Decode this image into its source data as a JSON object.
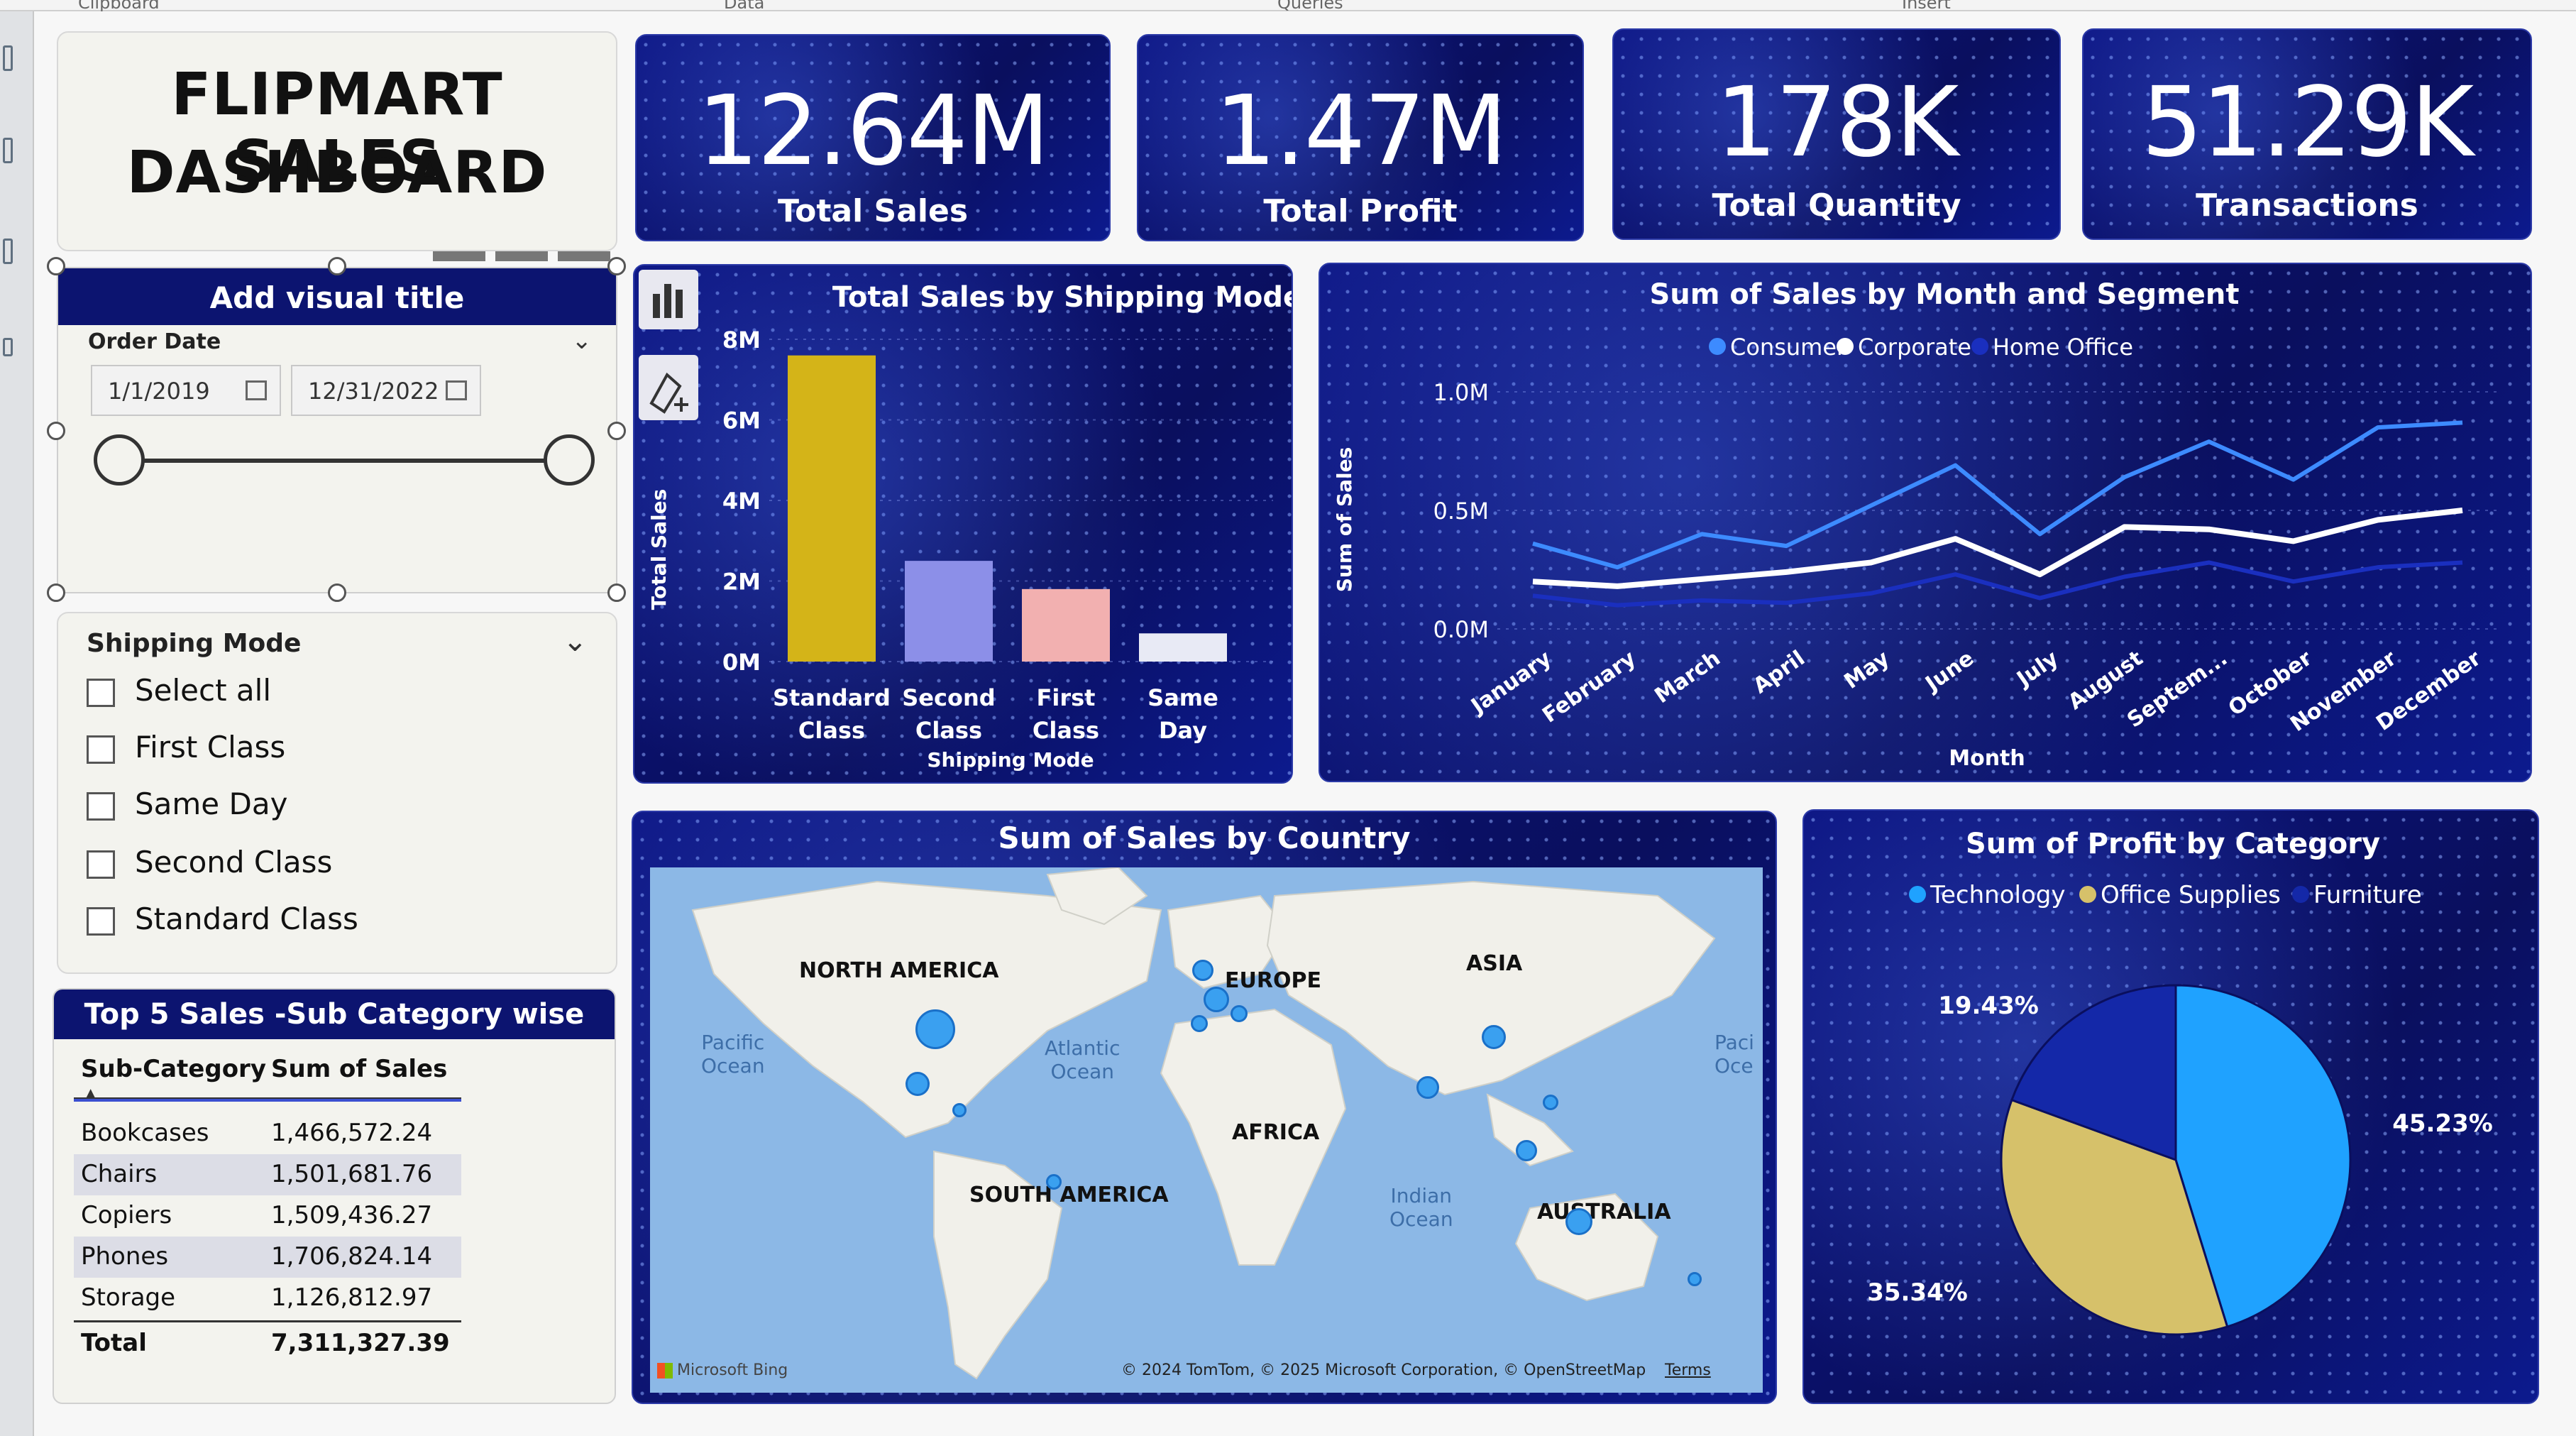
{
  "ribbon": {
    "labels": [
      "Clipboard",
      "Data",
      "Queries",
      "Insert"
    ]
  },
  "title": {
    "line1": "FLIPMART SALES",
    "line2": "DASHBOARD"
  },
  "kpis": [
    {
      "value": "12.64M",
      "label": "Total Sales"
    },
    {
      "value": "1.47M",
      "label": "Total Profit"
    },
    {
      "value": "178K",
      "label": "Total Quantity"
    },
    {
      "value": "51.29K",
      "label": "Transactions"
    }
  ],
  "date_slicer": {
    "visual_title": "Add visual title",
    "header": "Order Date",
    "start": "1/1/2019",
    "end": "12/31/2022",
    "range": [
      0,
      1
    ]
  },
  "shipping_slicer": {
    "header": "Shipping Mode",
    "options": [
      "Select all",
      "First Class",
      "Same Day",
      "Second Class",
      "Standard Class"
    ]
  },
  "top5": {
    "title": "Top 5 Sales -Sub Category wise",
    "columns": [
      "Sub-Category",
      "Sum of Sales"
    ],
    "rows": [
      [
        "Bookcases",
        "1,466,572.24"
      ],
      [
        "Chairs",
        "1,501,681.76"
      ],
      [
        "Copiers",
        "1,509,436.27"
      ],
      [
        "Phones",
        "1,706,824.14"
      ],
      [
        "Storage",
        "1,126,812.97"
      ]
    ],
    "total": [
      "Total",
      "7,311,327.39"
    ]
  },
  "map": {
    "title": "Sum of Sales by Country",
    "labels": [
      "NORTH AMERICA",
      "EUROPE",
      "ASIA",
      "AFRICA",
      "SOUTH AMERICA",
      "AUSTRALIA"
    ],
    "oceans": [
      "Pacific",
      "Ocean",
      "Atlantic",
      "Ocean",
      "Indian",
      "Ocean",
      "Paci",
      "Oce"
    ],
    "bing": "Microsoft Bing",
    "credits": "© 2024 TomTom, © 2025 Microsoft Corporation, © OpenStreetMap",
    "terms": "Terms"
  },
  "colors": {
    "navy": "#0a0f5e",
    "consumer": "#3d8bff",
    "corporate": "#ffffff",
    "home_office": "#1a2fbf",
    "standard": "#d4b418",
    "second": "#8c8fe8",
    "first": "#f2b0b0",
    "same": "#e8eaf5",
    "technology": "#1fa2ff",
    "office_supplies": "#d6c16a",
    "furniture": "#1428a8"
  },
  "chart_data": [
    {
      "type": "bar",
      "title": "Total Sales by Shipping Mode",
      "xlabel": "Shipping Mode",
      "ylabel": "Total Sales",
      "categories": [
        "Standard Class",
        "Second Class",
        "First Class",
        "Same Day"
      ],
      "values": [
        7.6,
        2.5,
        1.8,
        0.7
      ],
      "unit": "M",
      "yticks": [
        "0M",
        "2M",
        "4M",
        "6M",
        "8M"
      ],
      "ylim": [
        0,
        8
      ],
      "grid": true
    },
    {
      "type": "line",
      "title": "Sum of Sales by Month and Segment",
      "xlabel": "Month",
      "ylabel": "Sum of Sales",
      "categories": [
        "January",
        "February",
        "March",
        "April",
        "May",
        "June",
        "July",
        "August",
        "Septem...",
        "October",
        "November",
        "December"
      ],
      "yticks": [
        "0.0M",
        "0.5M",
        "1.0M"
      ],
      "ylim": [
        0,
        1.0
      ],
      "legend": "top",
      "series": [
        {
          "name": "Consumer",
          "values": [
            0.36,
            0.26,
            0.4,
            0.35,
            0.52,
            0.69,
            0.4,
            0.64,
            0.79,
            0.63,
            0.85,
            0.87
          ]
        },
        {
          "name": "Corporate",
          "values": [
            0.2,
            0.18,
            0.21,
            0.24,
            0.28,
            0.38,
            0.23,
            0.43,
            0.42,
            0.37,
            0.46,
            0.5
          ]
        },
        {
          "name": "Home Office",
          "values": [
            0.14,
            0.1,
            0.12,
            0.11,
            0.15,
            0.23,
            0.13,
            0.22,
            0.28,
            0.2,
            0.26,
            0.28
          ]
        }
      ]
    },
    {
      "type": "pie",
      "title": "Sum of Profit by Category",
      "legend": "top",
      "labels": [
        "Technology",
        "Office Supplies",
        "Furniture"
      ],
      "values": [
        45.23,
        35.34,
        19.43
      ],
      "value_labels": [
        "45.23%",
        "35.34%",
        "19.43%"
      ]
    }
  ]
}
